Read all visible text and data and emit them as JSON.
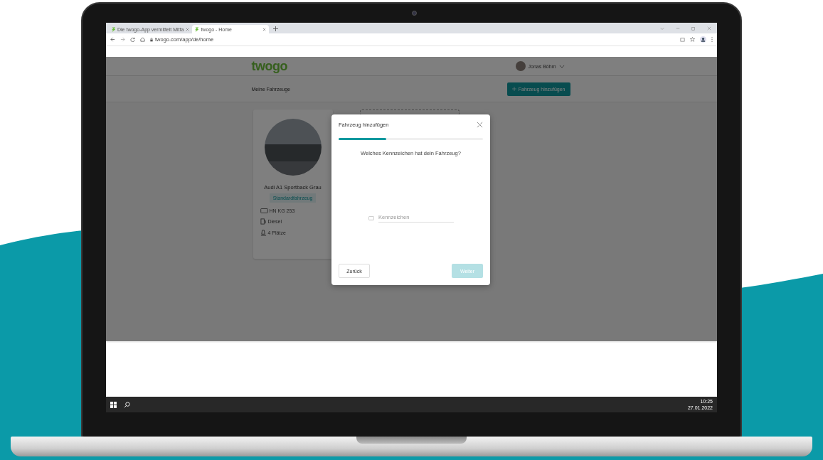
{
  "browser": {
    "tabs": [
      {
        "title": "Die twogo-App vermittelt Mitfa",
        "selected": false
      },
      {
        "title": "twogo - Home",
        "selected": true
      }
    ],
    "url": "twogo.com/app/de/home"
  },
  "site": {
    "logo": "twogo",
    "user": "Jonas Böhm",
    "page_title": "Meine Fahrzeuge",
    "add_button": "Fahrzeug hinzufügen"
  },
  "vehicle": {
    "name": "Audi A1 Sportback Grau",
    "badge": "Standardfahrzeug",
    "details": [
      {
        "kind": "plate",
        "text": "HN KG 253"
      },
      {
        "kind": "fuel",
        "text": "Diesel"
      },
      {
        "kind": "seats",
        "text": "4 Plätze"
      }
    ]
  },
  "dialog": {
    "title": "Fahrzeug hinzufügen",
    "progress": {
      "level": 0.33
    },
    "question": "Welches Kennzeichen hat dein Fahrzeug?",
    "field": {
      "placeholder": "Kennzeichen"
    },
    "back_button": "Zurück",
    "next_button": {
      "label": "Weiter",
      "disabled": true
    }
  },
  "taskbar": {
    "time": "10:25",
    "date": "27.01.2022"
  }
}
